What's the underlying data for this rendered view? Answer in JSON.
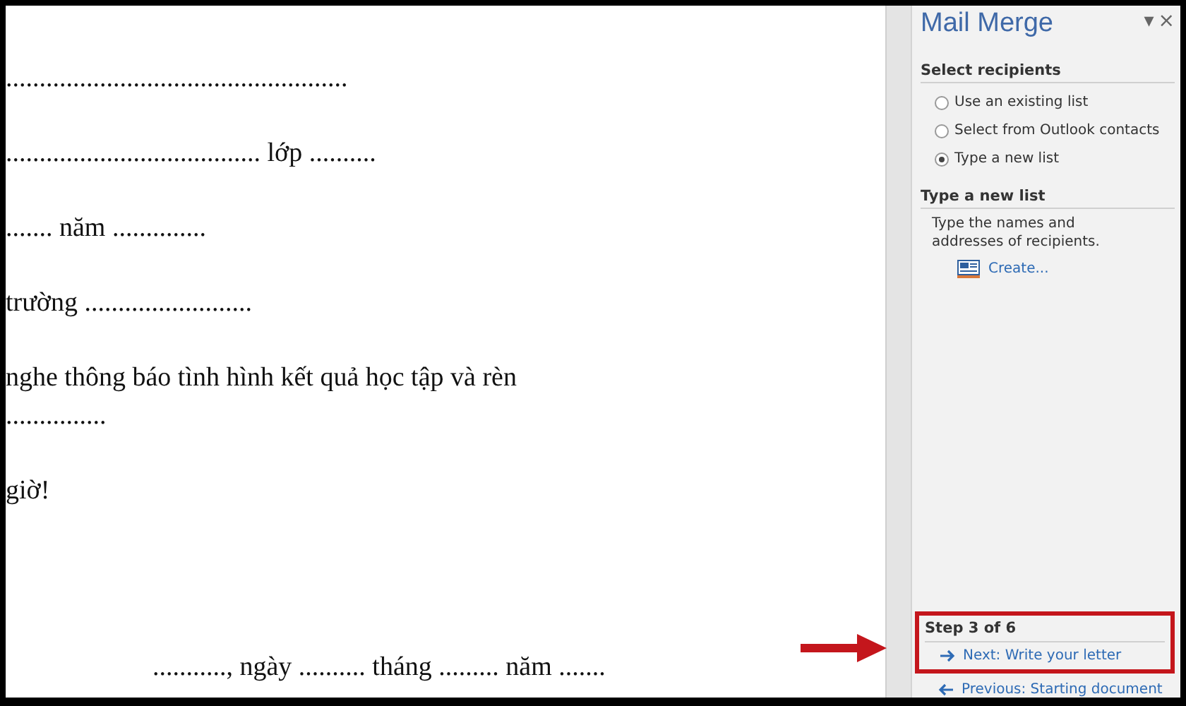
{
  "document": {
    "lines": [
      {
        "text": "..................................................."
      },
      {
        "text": "...................................... lớp .........."
      },
      {
        "text": "....... năm .............."
      },
      {
        "text": "trường ........................."
      },
      {
        "text": "nghe thông báo tình hình kết quả học tập và rèn\n..............."
      },
      {
        "text": "giờ!"
      }
    ],
    "date_line": "..........., ngày .......... tháng ......... năm ......."
  },
  "task_pane": {
    "title": "Mail Merge",
    "menu_glyph": "▾",
    "close_glyph": "×",
    "sections": [
      {
        "heading": "Select recipients",
        "options": [
          {
            "label": "Use an existing list",
            "selected": false
          },
          {
            "label": "Select from Outlook contacts",
            "selected": false
          },
          {
            "label": "Type a new list",
            "selected": true
          }
        ]
      },
      {
        "heading": "Type a new list",
        "description": "Type the names and addresses of recipients.",
        "link": "Create..."
      }
    ],
    "step": {
      "label": "Step 3 of 6",
      "highlighted": true,
      "next": "Next: Write your letter",
      "previous": "Previous: Starting document"
    }
  }
}
